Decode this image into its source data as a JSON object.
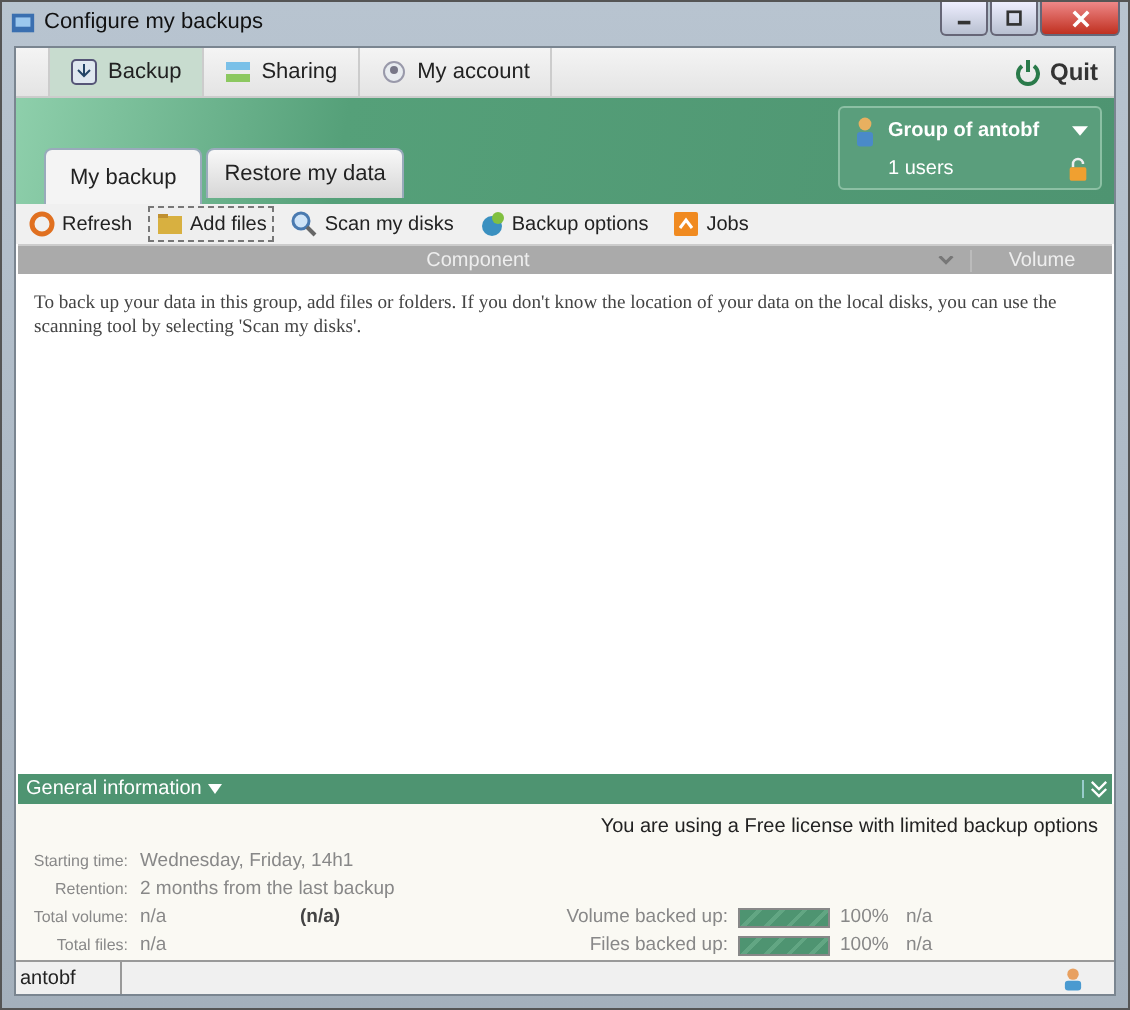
{
  "window": {
    "title": "Configure my backups"
  },
  "main_tabs": [
    {
      "label": "Backup",
      "selected": true
    },
    {
      "label": "Sharing",
      "selected": false
    },
    {
      "label": "My account",
      "selected": false
    }
  ],
  "quit": "Quit",
  "group": {
    "name": "Group of antobf",
    "users": "1 users"
  },
  "sub_tabs": [
    {
      "label": "My backup",
      "selected": true
    },
    {
      "label": "Restore my data",
      "selected": false
    }
  ],
  "toolbar": [
    {
      "label": "Refresh",
      "kind": "refresh",
      "selected": false
    },
    {
      "label": "Add files",
      "kind": "add",
      "selected": true
    },
    {
      "label": "Scan my disks",
      "kind": "scan",
      "selected": false
    },
    {
      "label": "Backup options",
      "kind": "options",
      "selected": false
    },
    {
      "label": "Jobs",
      "kind": "jobs",
      "selected": false
    }
  ],
  "table": {
    "columns": [
      "Component",
      "Volume"
    ],
    "hint": "To back up your data in this group, add files or folders. If you don't know the location of your data on the local disks, you can use the scanning tool by selecting 'Scan my disks'."
  },
  "info": {
    "title": "General information",
    "license": "You are using a Free license with limited backup options",
    "starting_label": "Starting time:",
    "starting": "Wednesday, Friday,  14h1",
    "retention_label": "Retention:",
    "retention": "2 months from the last backup",
    "total_volume_label": "Total volume:",
    "total_volume": "n/a",
    "total_volume_extra": "(n/a)",
    "total_files_label": "Total files:",
    "total_files": "n/a",
    "meters": [
      {
        "label": "Volume backed up:",
        "level": 1,
        "percent": "100%",
        "value": "n/a"
      },
      {
        "label": "Files backed up:",
        "level": 1,
        "percent": "100%",
        "value": "n/a"
      }
    ]
  },
  "status_bar": {
    "user": "antobf"
  }
}
